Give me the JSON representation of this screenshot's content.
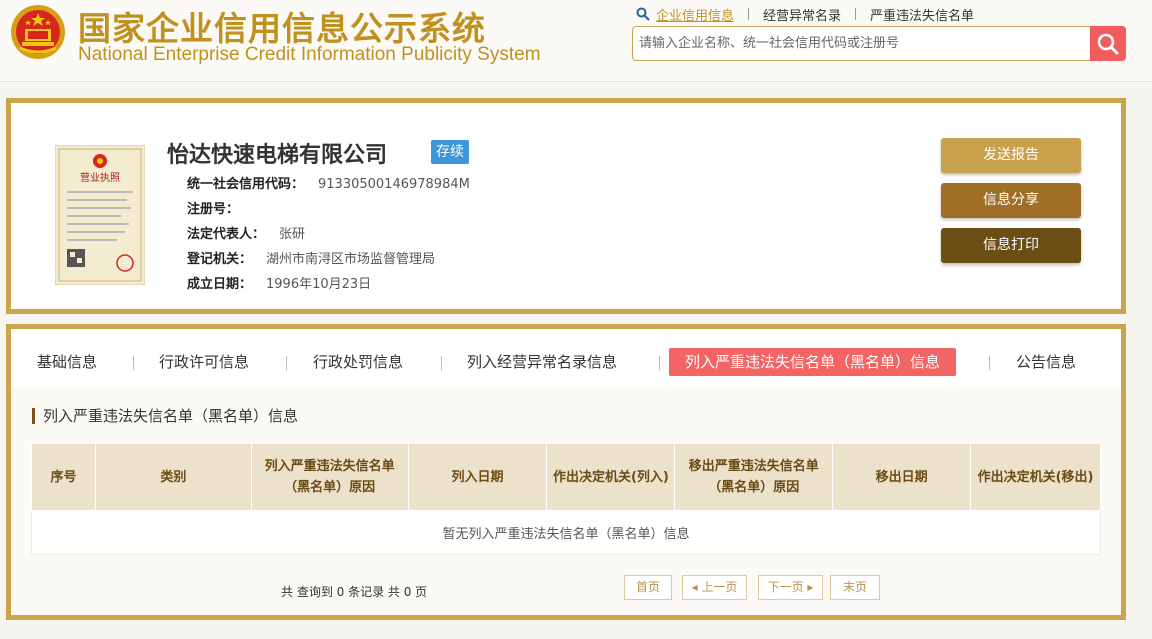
{
  "header": {
    "title_cn": "国家企业信用信息公示系统",
    "title_en": "National Enterprise Credit Information Publicity System",
    "search_links": [
      "企业信用信息",
      "经营异常名录",
      "严重违法失信名单"
    ],
    "search_placeholder": "请输入企业名称、统一社会信用代码或注册号"
  },
  "company": {
    "name": "怡达快速电梯有限公司",
    "status": "存续",
    "license_title": "营业执照",
    "fields": [
      {
        "label": "统一社会信用代码：",
        "value": "91330500146978984M"
      },
      {
        "label": "注册号：",
        "value": ""
      },
      {
        "label": "法定代表人：",
        "value": "张研"
      },
      {
        "label": "登记机关：",
        "value": "湖州市南浔区市场监督管理局"
      },
      {
        "label": "成立日期：",
        "value": "1996年10月23日"
      }
    ],
    "actions": {
      "report": "发送报告",
      "share": "信息分享",
      "print": "信息打印"
    }
  },
  "tabs": [
    {
      "label": "基础信息",
      "active": false
    },
    {
      "label": "行政许可信息",
      "active": false
    },
    {
      "label": "行政处罚信息",
      "active": false
    },
    {
      "label": "列入经营异常名录信息",
      "active": false
    },
    {
      "label": "列入严重违法失信名单（黑名单）信息",
      "active": true
    },
    {
      "label": "公告信息",
      "active": false
    }
  ],
  "section": {
    "title": "列入严重违法失信名单（黑名单）信息",
    "columns": [
      "序号",
      "类别",
      "列入严重违法失信名单（黑名单）原因",
      "列入日期",
      "作出决定机关(列入)",
      "移出严重违法失信名单（黑名单）原因",
      "移出日期",
      "作出决定机关(移出)"
    ],
    "empty_text": "暂无列入严重违法失信名单（黑名单）信息",
    "result_count": "共 查询到 0 条记录 共 0 页"
  },
  "pagination": {
    "first": "首页",
    "prev": "上一页",
    "next": "下一页",
    "last": "末页"
  },
  "colors": {
    "brand_gold": "#c0911f",
    "panel_border": "#c9a54d",
    "active_tab": "#f36464",
    "status_badge": "#3a97d8"
  }
}
